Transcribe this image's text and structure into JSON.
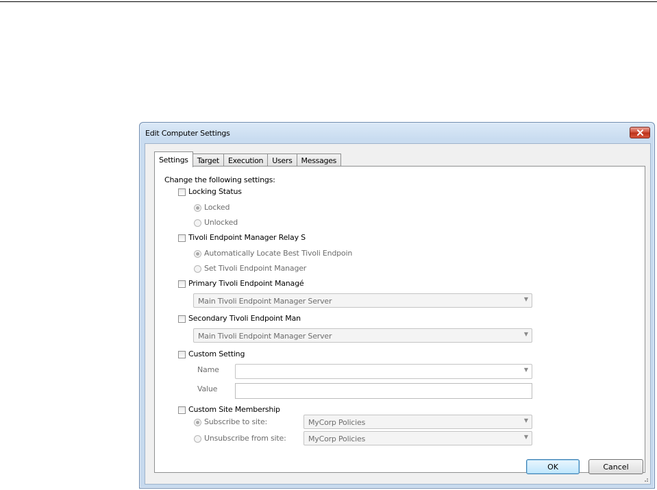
{
  "dialog": {
    "title": "Edit Computer Settings",
    "tabs": [
      "Settings",
      "Target",
      "Execution",
      "Users",
      "Messages"
    ],
    "active_tab": "Settings"
  },
  "settings": {
    "heading": "Change the following settings:",
    "locking_status": {
      "label": "Locking Status",
      "checked": false,
      "options": [
        "Locked",
        "Unlocked"
      ],
      "selected": "Locked"
    },
    "relay": {
      "label": "Tivoli Endpoint Manager Relay S",
      "checked": false,
      "options": [
        "Automatically Locate Best Tivoli Endpoin",
        "Set Tivoli Endpoint Manager"
      ],
      "selected": "Automatically Locate Best Tivoli Endpoin"
    },
    "primary": {
      "label": "Primary Tivoli Endpoint Managé",
      "checked": false,
      "value": "Main Tivoli Endpoint Manager Server"
    },
    "secondary": {
      "label": "Secondary Tivoli Endpoint Man",
      "checked": false,
      "value": "Main Tivoli Endpoint Manager Server"
    },
    "custom_setting": {
      "label": "Custom Setting",
      "checked": false,
      "name_label": "Name",
      "name_value": "",
      "value_label": "Value",
      "value_value": ""
    },
    "custom_site": {
      "label": "Custom Site Membership",
      "checked": false,
      "subscribe_label": "Subscribe to site:",
      "subscribe_value": "MyCorp Policies",
      "unsubscribe_label": "Unsubscribe from site:",
      "unsubscribe_value": "MyCorp Policies",
      "selected": "subscribe"
    }
  },
  "buttons": {
    "ok": "OK",
    "cancel": "Cancel"
  },
  "icons": {
    "close": "close-icon",
    "dropdown": "chevron-down-icon",
    "resize": "resize-grip-icon"
  },
  "colors": {
    "title_bar": "#c9dcf0",
    "close_button": "#cf4a33",
    "default_button": "#3c7fb1"
  }
}
